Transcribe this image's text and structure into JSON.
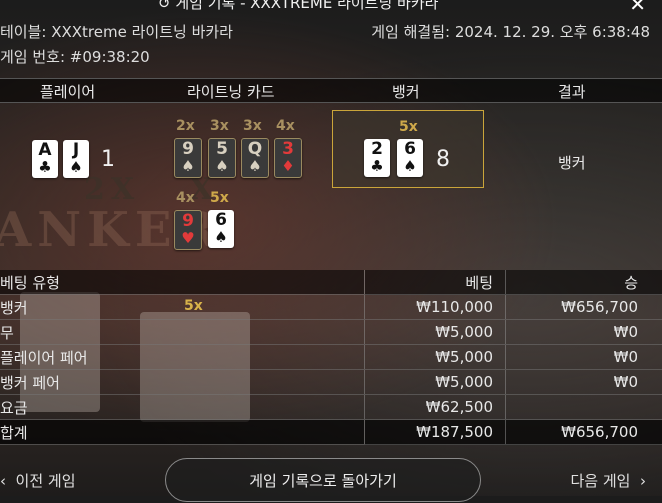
{
  "header": {
    "title": "↺ 게임 기록 - XXXTREME 라이트닝 바카라",
    "close_icon": "close-icon"
  },
  "info": {
    "table": "테이블: XXXtreme 라이트닝 바카라",
    "game_no": "게임 번호: #09:38:20",
    "resolved": "게임 해결됨: 2024. 12. 29. 오후 6:38:48"
  },
  "columns": {
    "player": "플레이어",
    "lightning": "라이트닝 카드",
    "banker": "뱅커",
    "result": "결과"
  },
  "player": {
    "cards": [
      {
        "rank": "A",
        "suit": "♣"
      },
      {
        "rank": "J",
        "suit": "♠"
      }
    ],
    "score": "1"
  },
  "lightning": {
    "row1": [
      {
        "mult": "2x",
        "rank": "9",
        "suit": "♠"
      },
      {
        "mult": "3x",
        "rank": "5",
        "suit": "♠"
      },
      {
        "mult": "3x",
        "rank": "Q",
        "suit": "♠"
      },
      {
        "mult": "4x",
        "rank": "3",
        "suit": "♦"
      }
    ],
    "row2": [
      {
        "mult": "4x",
        "rank": "9",
        "suit": "♥"
      },
      {
        "mult": "5x",
        "rank": "6",
        "suit": "♠"
      }
    ]
  },
  "banker": {
    "mult": "5x",
    "cards": [
      {
        "rank": "2",
        "suit": "♣"
      },
      {
        "rank": "6",
        "suit": "♠"
      }
    ],
    "score": "8"
  },
  "result": "뱅커",
  "bets": {
    "headers": {
      "type": "베팅 유형",
      "bet": "베팅",
      "win": "승"
    },
    "rows": [
      {
        "type": "뱅커",
        "mult": "5x",
        "bet": "₩110,000",
        "win": "₩656,700"
      },
      {
        "type": "무",
        "bet": "₩5,000",
        "win": "₩0"
      },
      {
        "type": "플레이어 페어",
        "bet": "₩5,000",
        "win": "₩0"
      },
      {
        "type": "뱅커 페어",
        "bet": "₩5,000",
        "win": "₩0"
      },
      {
        "type": "요금",
        "bet": "₩62,500",
        "win": ""
      }
    ],
    "total": {
      "type": "합계",
      "bet": "₩187,500",
      "win": "₩656,700"
    }
  },
  "footer": {
    "prev": "이전 게임",
    "back": "게임 기록으로 돌아가기",
    "next": "다음 게임"
  },
  "colors": {
    "accent_gold": "#caa53a",
    "red_suit": "#c8102e"
  }
}
